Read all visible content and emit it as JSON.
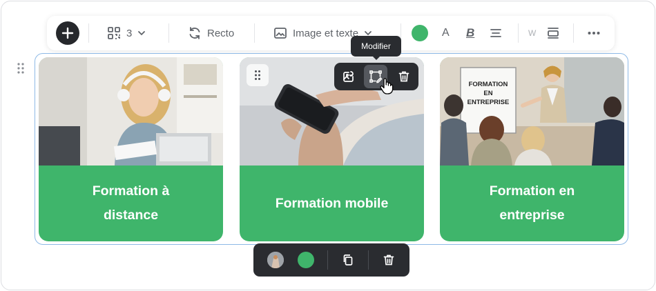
{
  "toolbar": {
    "columns_label": "3",
    "side_label": "Recto",
    "layout_label": "Image et texte",
    "accent_color": "#3fb56b",
    "font_letter": "A",
    "bold_letter": "B",
    "width_letter": "W",
    "icons": [
      "plus-icon",
      "grid-icon",
      "chevron-down-icon",
      "rotate-icon",
      "image-icon",
      "text-color-icon",
      "bold-icon",
      "align-icon",
      "border-icon",
      "more-icon"
    ]
  },
  "tooltip": {
    "text": "Modifier"
  },
  "cards": [
    {
      "caption": "Formation à distance",
      "image": "woman-with-headphones-laptop-photo"
    },
    {
      "caption": "Formation mobile",
      "image": "hands-holding-smartphone-photo"
    },
    {
      "caption": "Formation en entreprise",
      "image": "meeting-presentation-flipchart-photo",
      "flipchart_text": "FORMATION EN ENTREPRISE"
    }
  ],
  "card_actions": {
    "icons": [
      "replace-image-icon",
      "edit-crop-icon",
      "trash-icon"
    ],
    "active": "edit-crop-icon"
  },
  "bottom_toolbar": {
    "color": "#3fb56b",
    "icons": [
      "image-thumbnail",
      "color-swatch",
      "duplicate-icon",
      "trash-icon"
    ]
  }
}
